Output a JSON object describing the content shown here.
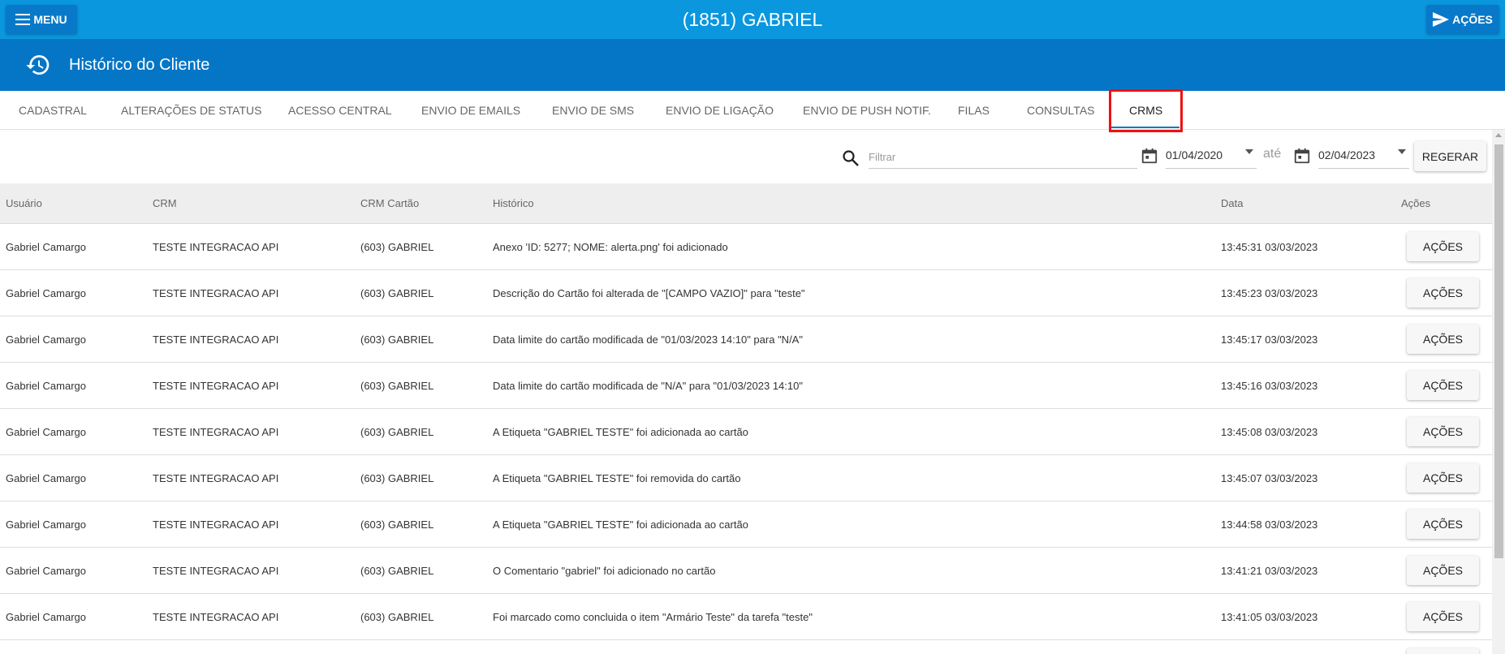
{
  "topbar": {
    "menu_label": "MENU",
    "title": "(1851) GABRIEL",
    "actions_label": "AÇÕES"
  },
  "subheader": {
    "title": "Histórico do Cliente"
  },
  "tabs": [
    {
      "label": "CADASTRAL"
    },
    {
      "label": "ALTERAÇÕES DE STATUS"
    },
    {
      "label": "ACESSO CENTRAL"
    },
    {
      "label": "ENVIO DE EMAILS"
    },
    {
      "label": "ENVIO DE SMS"
    },
    {
      "label": "ENVIO DE LIGAÇÃO"
    },
    {
      "label": "ENVIO DE PUSH NOTIF."
    },
    {
      "label": "FILAS"
    },
    {
      "label": "CONSULTAS"
    },
    {
      "label": "CRMS"
    }
  ],
  "active_tab": "CRMS",
  "filters": {
    "search_placeholder": "Filtrar",
    "date_from": "01/04/2020",
    "separator": "até",
    "date_to": "02/04/2023",
    "regenerate_label": "REGERAR"
  },
  "table": {
    "columns": [
      "Usuário",
      "CRM",
      "CRM Cartão",
      "Histórico",
      "Data",
      "Ações"
    ],
    "row_action_label": "AÇÕES",
    "rows": [
      {
        "usuario": "Gabriel Camargo",
        "crm": "TESTE INTEGRACAO API",
        "cartao": "(603) GABRIEL",
        "historico": "Anexo 'ID: 5277; NOME: alerta.png' foi adicionado",
        "data": "13:45:31 03/03/2023"
      },
      {
        "usuario": "Gabriel Camargo",
        "crm": "TESTE INTEGRACAO API",
        "cartao": "(603) GABRIEL",
        "historico": "Descrição do Cartão foi alterada de \"[CAMPO VAZIO]\" para \"teste\"",
        "data": "13:45:23 03/03/2023"
      },
      {
        "usuario": "Gabriel Camargo",
        "crm": "TESTE INTEGRACAO API",
        "cartao": "(603) GABRIEL",
        "historico": "Data limite do cartão modificada de \"01/03/2023 14:10\" para \"N/A\"",
        "data": "13:45:17 03/03/2023"
      },
      {
        "usuario": "Gabriel Camargo",
        "crm": "TESTE INTEGRACAO API",
        "cartao": "(603) GABRIEL",
        "historico": "Data limite do cartão modificada de \"N/A\" para \"01/03/2023 14:10\"",
        "data": "13:45:16 03/03/2023"
      },
      {
        "usuario": "Gabriel Camargo",
        "crm": "TESTE INTEGRACAO API",
        "cartao": "(603) GABRIEL",
        "historico": "A Etiqueta \"GABRIEL TESTE\" foi adicionada ao cartão",
        "data": "13:45:08 03/03/2023"
      },
      {
        "usuario": "Gabriel Camargo",
        "crm": "TESTE INTEGRACAO API",
        "cartao": "(603) GABRIEL",
        "historico": "A Etiqueta \"GABRIEL TESTE\" foi removida do cartão",
        "data": "13:45:07 03/03/2023"
      },
      {
        "usuario": "Gabriel Camargo",
        "crm": "TESTE INTEGRACAO API",
        "cartao": "(603) GABRIEL",
        "historico": "A Etiqueta \"GABRIEL TESTE\" foi adicionada ao cartão",
        "data": "13:44:58 03/03/2023"
      },
      {
        "usuario": "Gabriel Camargo",
        "crm": "TESTE INTEGRACAO API",
        "cartao": "(603) GABRIEL",
        "historico": "O Comentario \"gabriel\" foi adicionado no cartão",
        "data": "13:41:21 03/03/2023"
      },
      {
        "usuario": "Gabriel Camargo",
        "crm": "TESTE INTEGRACAO API",
        "cartao": "(603) GABRIEL",
        "historico": "Foi marcado como concluida o item \"Armário Teste\" da tarefa \"teste\"",
        "data": "13:41:05 03/03/2023"
      }
    ]
  },
  "colors": {
    "topbar": "#0a97de",
    "subheader": "#0576c6",
    "highlight": "#ee1111"
  }
}
